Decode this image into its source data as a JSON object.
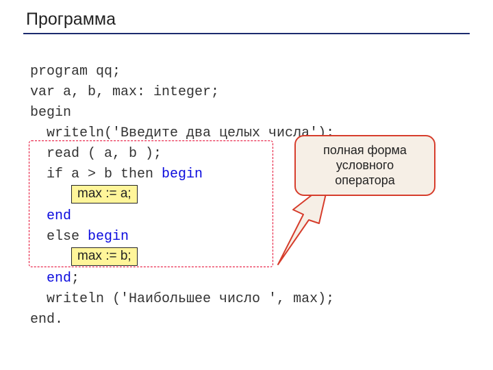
{
  "title": "Программа",
  "code": {
    "l1": "program qq;",
    "l2": "var a, b, max: integer;",
    "l3": "begin",
    "l4": "  writeln('Введите два целых числа');",
    "l5": "  read ( a, b );",
    "l6a": "  if a > b then ",
    "l6b": "begin",
    "l7_highlight": "max := a;",
    "l8": "end",
    "l9a": "  else ",
    "l9b": "begin",
    "l10_highlight": "max := b;",
    "l11": "end",
    "l11_semi": ";",
    "l12": "  writeln ('Наибольшее число ', max);",
    "l13": "end."
  },
  "callout": {
    "line1": "полная форма",
    "line2": "условного",
    "line3": "оператора"
  }
}
